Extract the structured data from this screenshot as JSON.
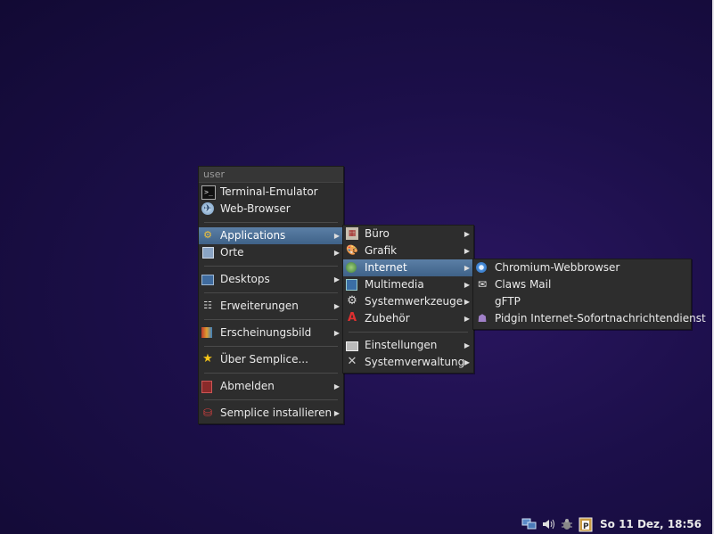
{
  "main_menu": {
    "header": "user",
    "items": [
      {
        "label": "Terminal-Emulator",
        "icon": "terminal-icon"
      },
      {
        "label": "Web-Browser",
        "icon": "globe-icon"
      },
      {
        "label": "Applications",
        "icon": "applications-icon"
      },
      {
        "label": "Orte",
        "icon": "places-icon"
      },
      {
        "label": "Desktops",
        "icon": "desktops-icon"
      },
      {
        "label": "Erweiterungen",
        "icon": "extensions-icon"
      },
      {
        "label": "Erscheinungsbild",
        "icon": "appearance-icon"
      },
      {
        "label": "Über Semplice...",
        "icon": "star-icon"
      },
      {
        "label": "Abmelden",
        "icon": "logout-icon"
      },
      {
        "label": "Semplice installieren",
        "icon": "install-icon"
      }
    ]
  },
  "applications_menu": {
    "items": [
      {
        "label": "Büro",
        "icon": "office-icon"
      },
      {
        "label": "Grafik",
        "icon": "graphics-icon"
      },
      {
        "label": "Internet",
        "icon": "internet-icon"
      },
      {
        "label": "Multimedia",
        "icon": "multimedia-icon"
      },
      {
        "label": "Systemwerkzeuge",
        "icon": "gear-icon"
      },
      {
        "label": "Zubehör",
        "icon": "accessories-icon"
      },
      {
        "label": "Einstellungen",
        "icon": "settings-icon"
      },
      {
        "label": "Systemverwaltung",
        "icon": "tools-icon"
      }
    ]
  },
  "internet_menu": {
    "items": [
      {
        "label": "Chromium-Webbrowser",
        "icon": "chromium-icon"
      },
      {
        "label": "Claws Mail",
        "icon": "mail-icon"
      },
      {
        "label": "gFTP",
        "icon": ""
      },
      {
        "label": "Pidgin Internet-Sofortnachrichtendienst",
        "icon": "pidgin-icon"
      }
    ]
  },
  "tray": {
    "clock": "So 11 Dez, 18:56",
    "icons": [
      "network-icon",
      "volume-icon",
      "bug-icon",
      "paste-icon"
    ]
  },
  "colors": {
    "accent": "#4c7098",
    "menu_bg": "#2d2d2d",
    "desktop": "#1c0f4a"
  }
}
